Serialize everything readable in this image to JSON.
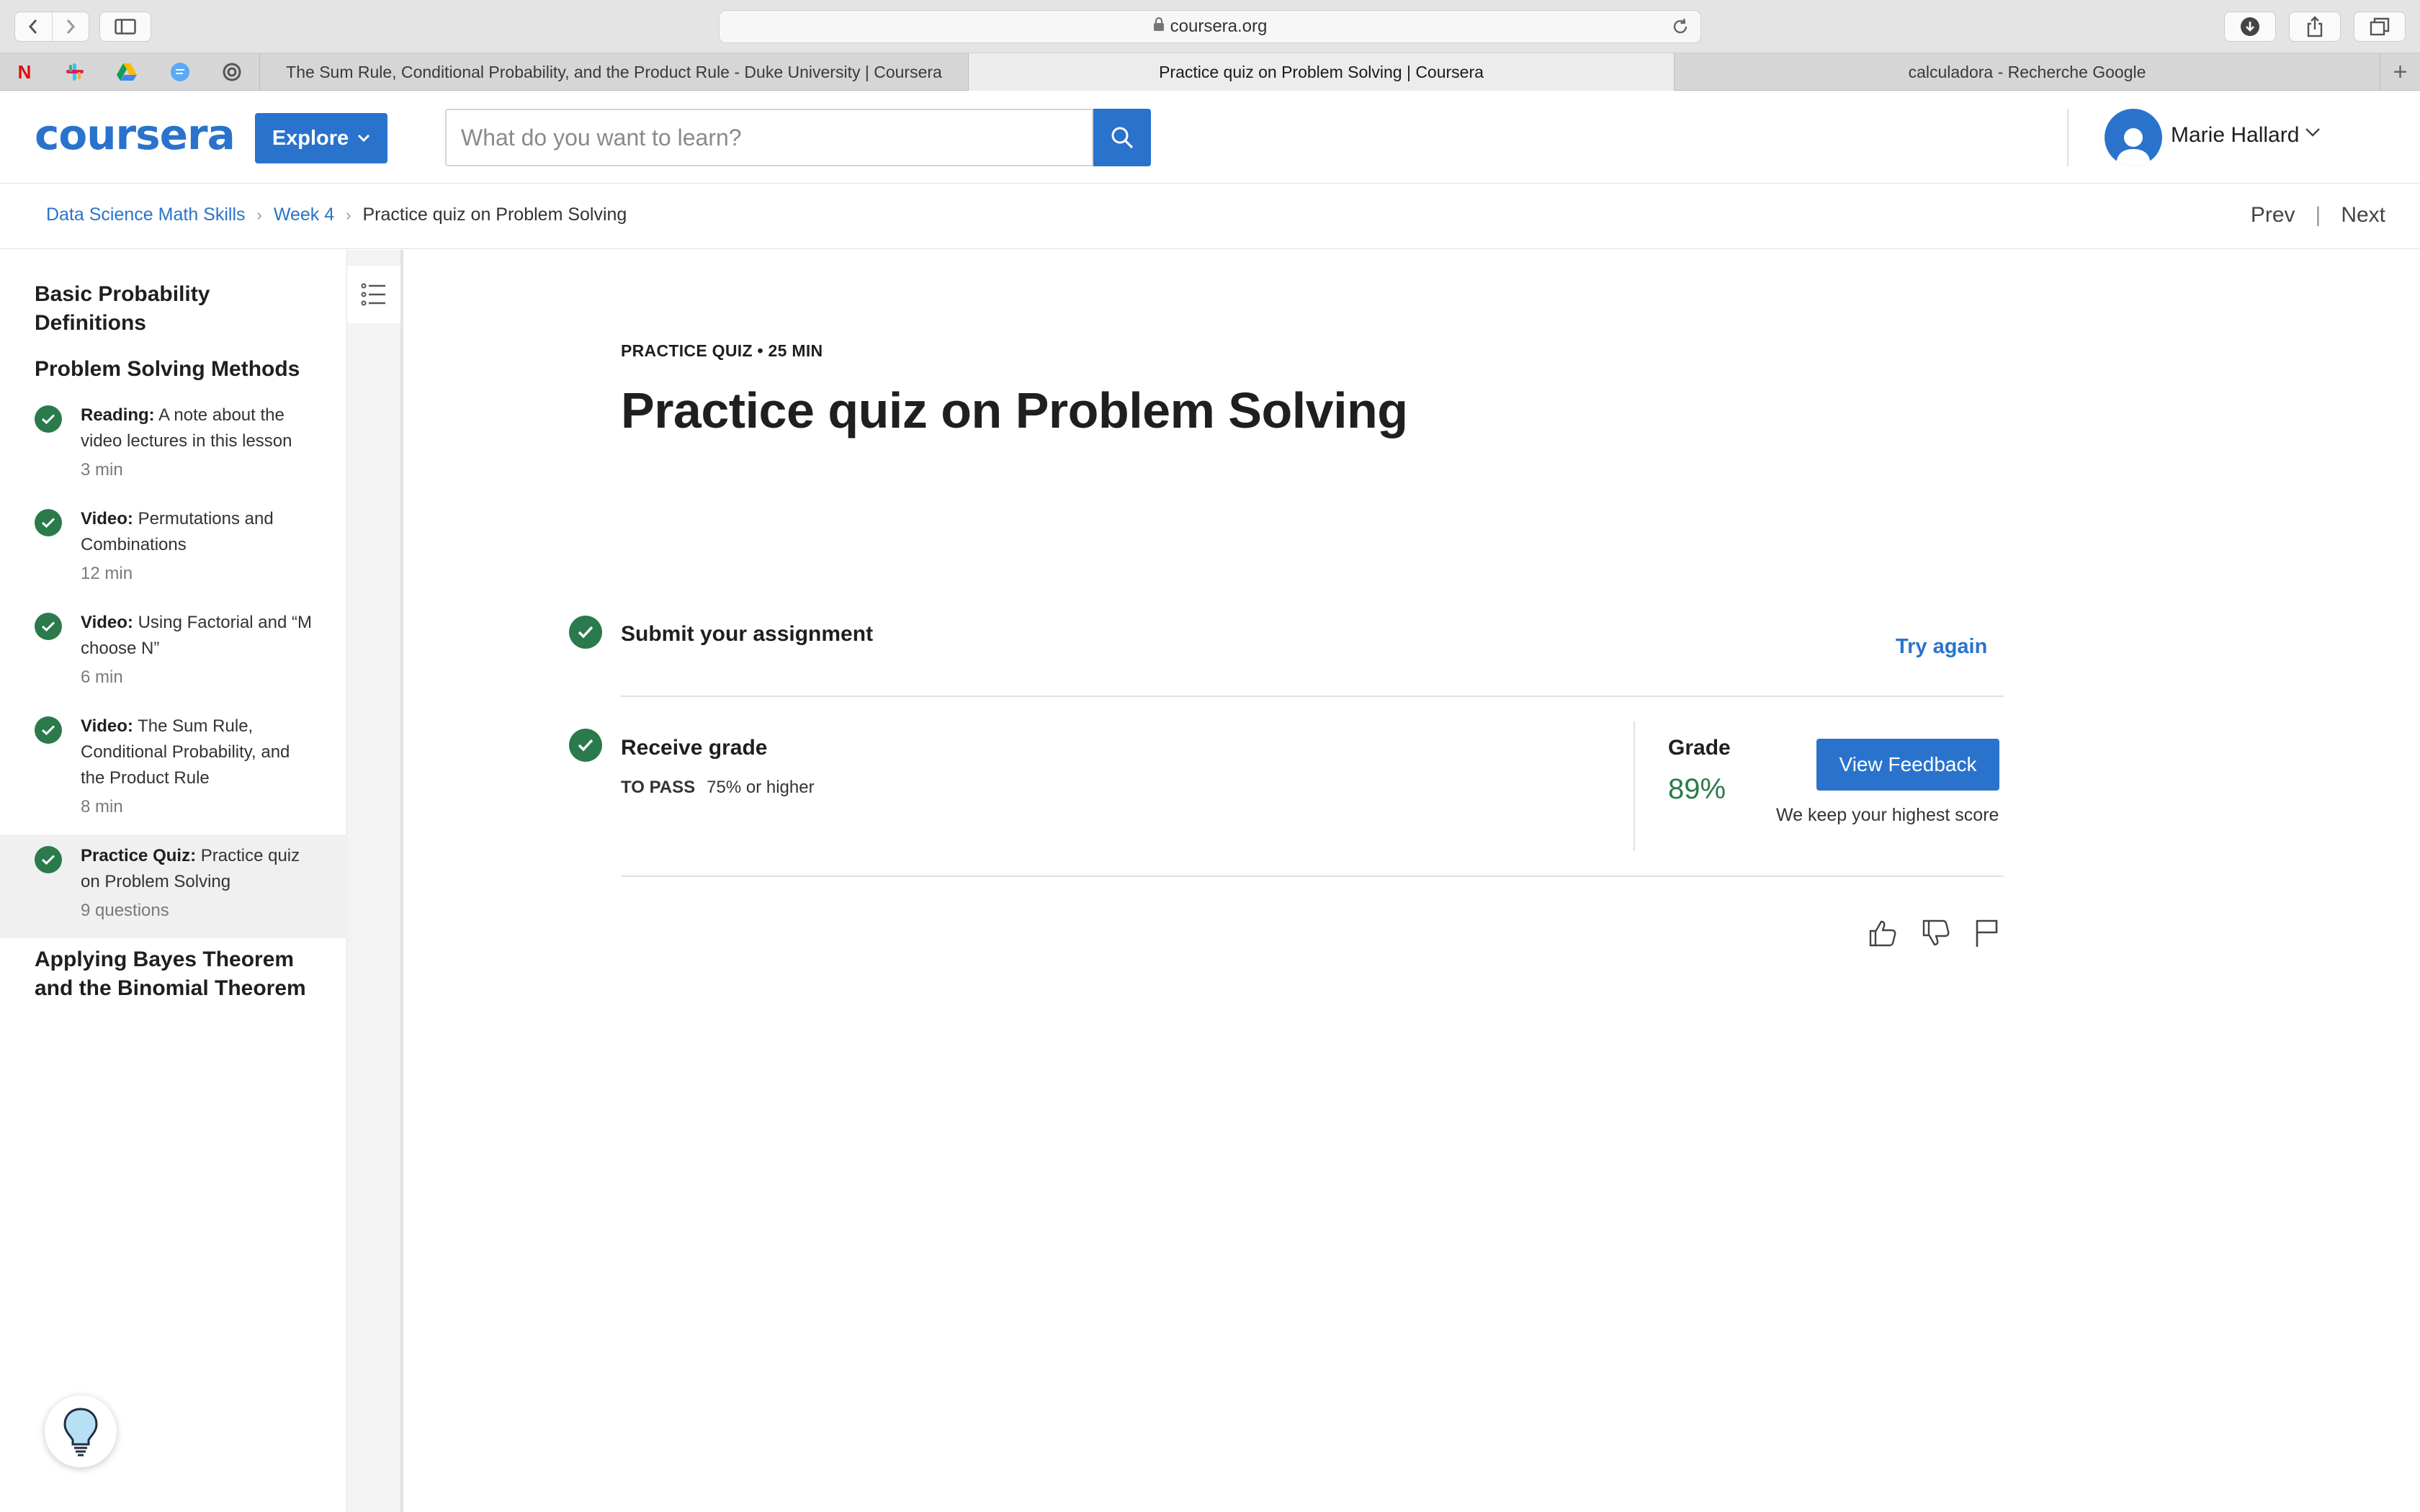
{
  "browser": {
    "url": "coursera.org",
    "tabs": [
      {
        "title": "The Sum Rule, Conditional Probability, and the Product Rule - Duke University | Coursera"
      },
      {
        "title": "Practice quiz on Problem Solving | Coursera"
      },
      {
        "title": "calculadora - Recherche Google"
      }
    ],
    "bookmarks": [
      "netflix-icon",
      "slack-icon",
      "drive-icon",
      "messages-icon",
      "spiral-icon"
    ]
  },
  "header": {
    "logo": "coursera",
    "explore_label": "Explore",
    "search_placeholder": "What do you want to learn?",
    "user_name": "Marie Hallard"
  },
  "breadcrumb": {
    "items": [
      "Data Science Math Skills",
      "Week 4"
    ],
    "current": "Practice quiz on Problem Solving",
    "prev": "Prev",
    "next": "Next"
  },
  "sidebar": {
    "sections": [
      {
        "title": "Basic Probability Definitions"
      },
      {
        "title": "Problem Solving Methods"
      },
      {
        "title": "Applying Bayes Theorem and the Binomial Theorem"
      }
    ],
    "items": [
      {
        "type": "Reading:",
        "name": "A note about the video lectures in this lesson",
        "meta": "3 min"
      },
      {
        "type": "Video:",
        "name": "Permutations and Combinations",
        "meta": "12 min"
      },
      {
        "type": "Video:",
        "name": "Using Factorial and “M choose N”",
        "meta": "6 min"
      },
      {
        "type": "Video:",
        "name": "The Sum Rule, Conditional Probability, and the Product Rule",
        "meta": "8 min"
      },
      {
        "type": "Practice Quiz:",
        "name": "Practice quiz on Problem Solving",
        "meta": "9 questions"
      }
    ]
  },
  "main": {
    "kicker": "PRACTICE QUIZ • 25 MIN",
    "title": "Practice quiz on Problem Solving",
    "submit_title": "Submit your assignment",
    "try_again": "Try again",
    "receive_title": "Receive grade",
    "to_pass_label": "TO PASS",
    "to_pass_value": "75% or higher",
    "grade_label": "Grade",
    "grade_value": "89%",
    "feedback_button": "View Feedback",
    "keep_note": "We keep your highest score"
  },
  "colors": {
    "brand": "#2a73cc",
    "success": "#2a7a4b"
  }
}
